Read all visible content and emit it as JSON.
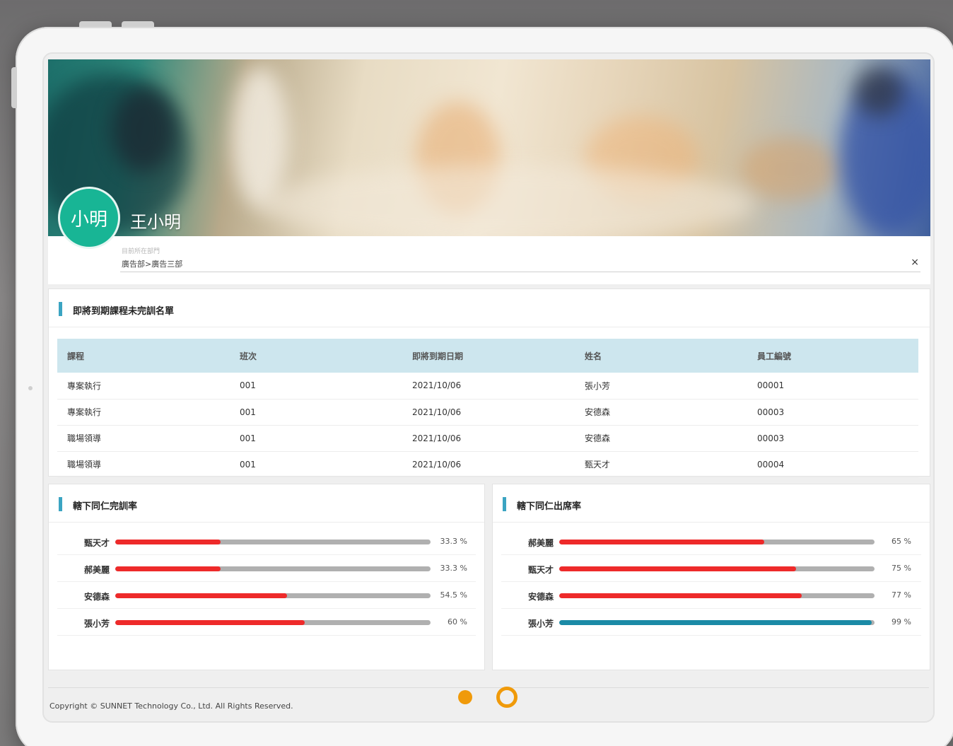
{
  "profile": {
    "avatar_text": "小明",
    "name": "王小明",
    "dept_label": "目前所在部門",
    "dept_value": "廣告部>廣告三部",
    "close_icon": "×"
  },
  "expiring": {
    "title": "即將到期課程未完訓名單",
    "columns": [
      "課程",
      "班次",
      "即將到期日期",
      "姓名",
      "員工編號"
    ],
    "rows": [
      [
        "專案執行",
        "001",
        "2021/10/06",
        "張小芳",
        "00001"
      ],
      [
        "專案執行",
        "001",
        "2021/10/06",
        "安德森",
        "00003"
      ],
      [
        "職場領導",
        "001",
        "2021/10/06",
        "安德森",
        "00003"
      ],
      [
        "職場領導",
        "001",
        "2021/10/06",
        "甄天才",
        "00004"
      ]
    ]
  },
  "completion": {
    "title": "轄下同仁完訓率",
    "items": [
      {
        "name": "甄天才",
        "value": 33.3,
        "label": "33.3 %",
        "color": "#ee2a2a"
      },
      {
        "name": "郝美麗",
        "value": 33.3,
        "label": "33.3 %",
        "color": "#ee2a2a"
      },
      {
        "name": "安德森",
        "value": 54.5,
        "label": "54.5 %",
        "color": "#ee2a2a"
      },
      {
        "name": "張小芳",
        "value": 60,
        "label": "60 %",
        "color": "#ee2a2a"
      }
    ]
  },
  "attendance": {
    "title": "轄下同仁出席率",
    "items": [
      {
        "name": "郝美麗",
        "value": 65,
        "label": "65 %",
        "color": "#ee2a2a"
      },
      {
        "name": "甄天才",
        "value": 75,
        "label": "75 %",
        "color": "#ee2a2a"
      },
      {
        "name": "安德森",
        "value": 77,
        "label": "77 %",
        "color": "#ee2a2a"
      },
      {
        "name": "張小芳",
        "value": 99,
        "label": "99 %",
        "color": "#1b8aa6"
      }
    ]
  },
  "footer": {
    "copyright": "Copyright © SUNNET Technology Co., Ltd. All Rights Reserved."
  },
  "pagination": {
    "pages": 2,
    "current": 2
  }
}
